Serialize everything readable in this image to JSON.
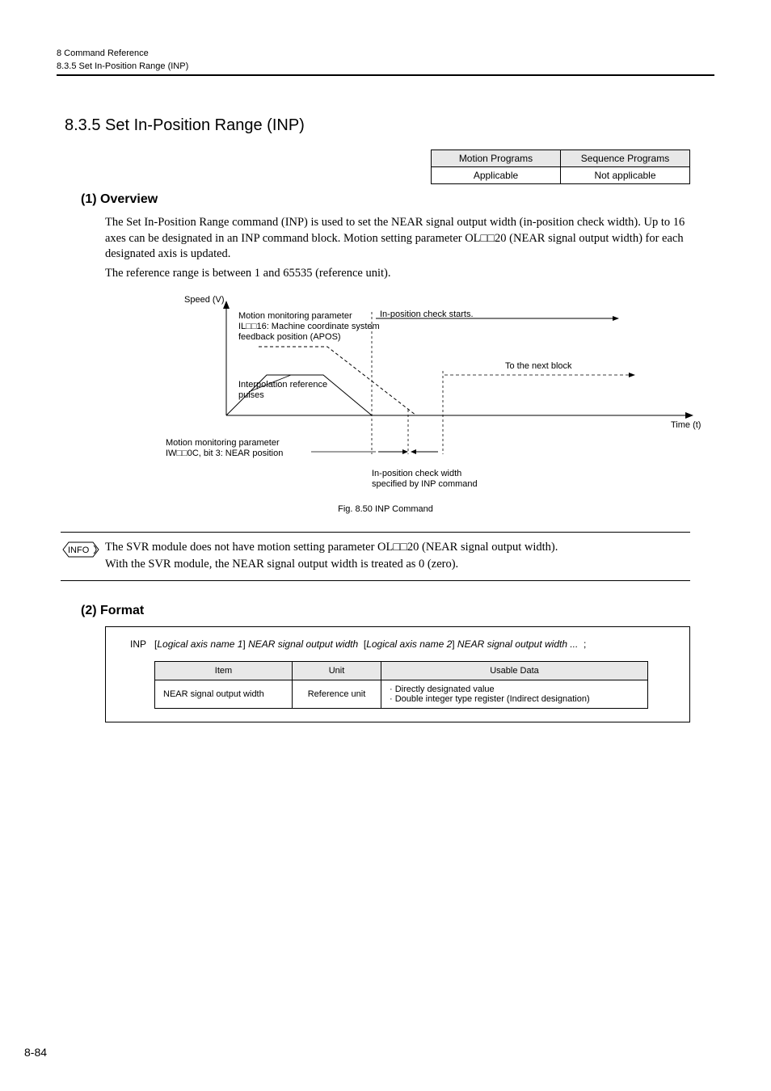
{
  "header": {
    "chapter": "8  Command Reference",
    "section": "8.3.5  Set In-Position Range (INP)"
  },
  "title": "8.3.5  Set In-Position Range (INP)",
  "appTable": {
    "h1": "Motion Programs",
    "h2": "Sequence Programs",
    "c1": "Applicable",
    "c2": "Not applicable"
  },
  "sub1": "(1) Overview",
  "p1": "The Set In-Position Range command (INP) is used to set the NEAR signal output width (in-position check width). Up to 16 axes can be designated in an INP command block. Motion setting parameter OL□□20 (NEAR signal output width) for each designated axis is updated.",
  "p2": "The reference range is between 1 and 65535 (reference unit).",
  "figure": {
    "speedV": "Speed (V)",
    "mmParam1a": "Motion monitoring parameter",
    "mmParam1b": "IL□□16: Machine coordinate system",
    "mmParam1c": "feedback position (APOS)",
    "inposStart": "In-position check starts.",
    "nextBlock": "To the next block",
    "interpA": "Interpolation reference",
    "interpB": "pulses",
    "timeT": "Time (t)",
    "mmParam2a": "Motion monitoring parameter",
    "mmParam2b": "IW□□0C, bit 3: NEAR position",
    "inposWidthA": "In-position check width",
    "inposWidthB": "specified by INP command",
    "caption": "Fig. 8.50  INP Command"
  },
  "info": {
    "label": "INFO",
    "l1": "The SVR module does not have motion setting parameter OL□□20 (NEAR signal output width).",
    "l2": "With the SVR module, the NEAR signal output width is treated as 0 (zero)."
  },
  "sub2": "(2) Format",
  "format": {
    "cmd": "INP",
    "ax1": "Logical axis name 1",
    "near1": "NEAR signal output width",
    "ax2": "Logical axis name 2",
    "near2": "NEAR signal output width",
    "ell": "...",
    "semi": ";",
    "th1": "Item",
    "th2": "Unit",
    "th3": "Usable Data",
    "r1c1": "NEAR signal output width",
    "r1c2": "Reference unit",
    "r1c3a": "· Directly designated value",
    "r1c3b": "· Double integer type register (Indirect designation)"
  },
  "pageNum": "8-84"
}
